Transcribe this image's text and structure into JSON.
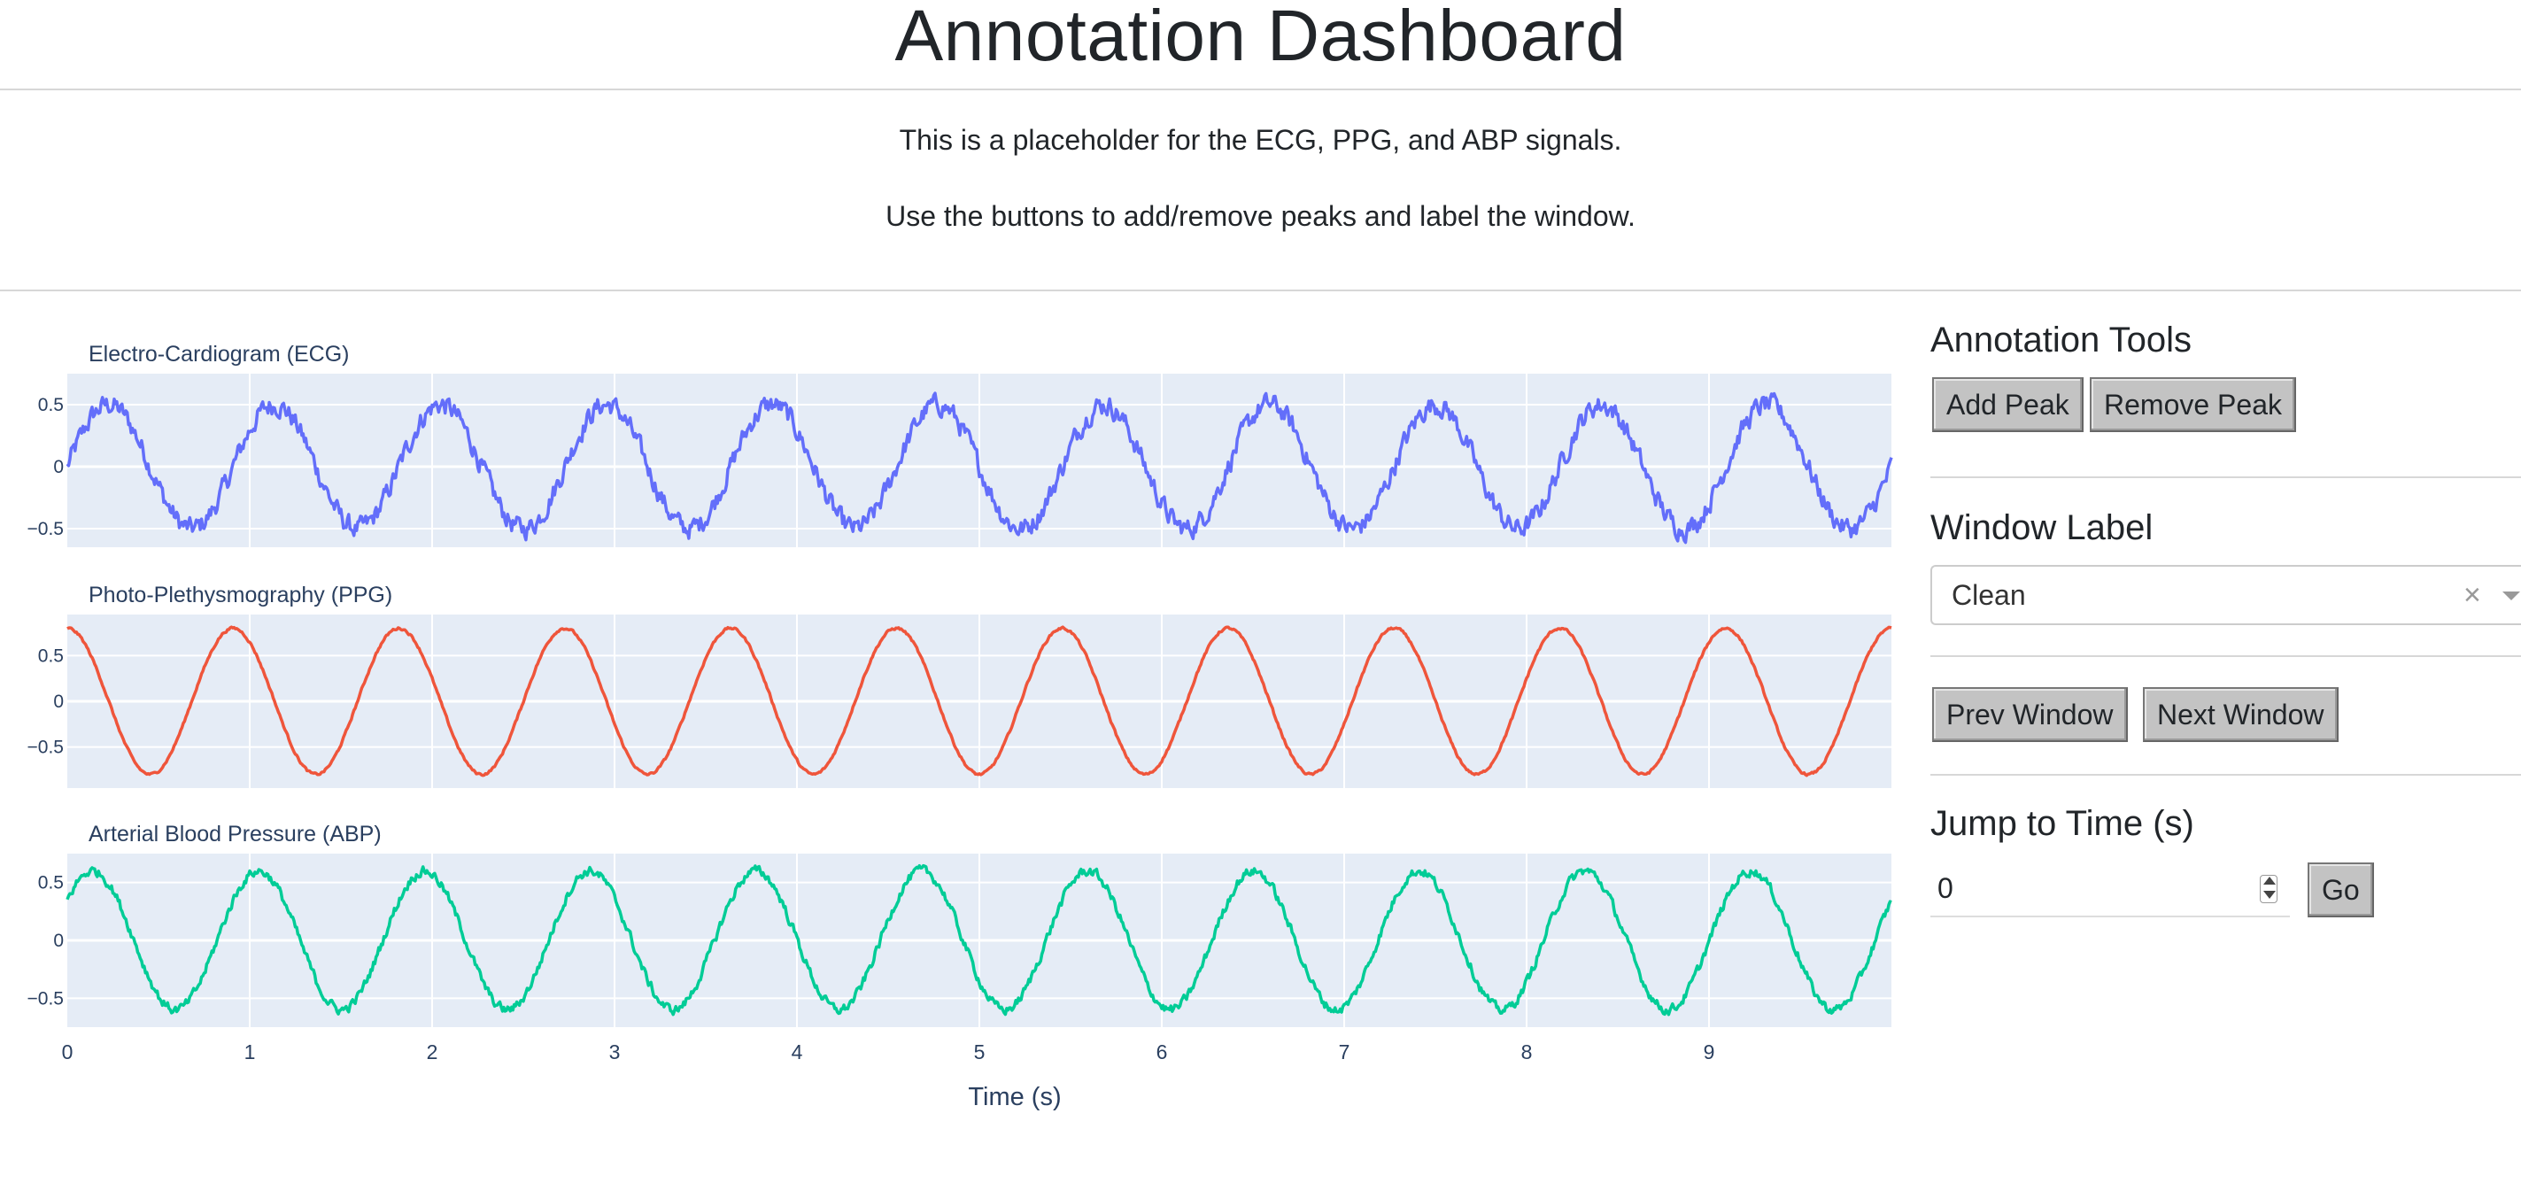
{
  "header": {
    "title": "Annotation Dashboard"
  },
  "intro": {
    "line1": "This is a placeholder for the ECG, PPG, and ABP signals.",
    "line2": "Use the buttons to add/remove peaks and label the window."
  },
  "sidebar": {
    "annotation_tools": {
      "heading": "Annotation Tools",
      "add_peak": "Add Peak",
      "remove_peak": "Remove Peak"
    },
    "window_label": {
      "heading": "Window Label",
      "selected": "Clean",
      "clear_glyph": "×"
    },
    "navigation": {
      "prev": "Prev Window",
      "next": "Next Window"
    },
    "jump": {
      "heading": "Jump to Time (s)",
      "value": "0",
      "go": "Go"
    }
  },
  "chart_data": [
    {
      "type": "line",
      "title": "Electro-Cardiogram (ECG)",
      "color": "#636efa",
      "xlim": [
        0,
        10
      ],
      "ylim": [
        -0.65,
        0.75
      ],
      "yticks": [
        -0.5,
        0,
        0.5
      ],
      "ytick_labels": [
        "−0.5",
        "0",
        "0.5"
      ],
      "frequency_hz": 1.1,
      "amplitude": 0.5,
      "phase_deg": 0,
      "noise": "high"
    },
    {
      "type": "line",
      "title": "Photo-Plethysmography (PPG)",
      "color": "#ef553b",
      "xlim": [
        0,
        10
      ],
      "ylim": [
        -0.95,
        0.95
      ],
      "yticks": [
        -0.5,
        0,
        0.5
      ],
      "ytick_labels": [
        "−0.5",
        "0",
        "0.5"
      ],
      "frequency_hz": 1.1,
      "amplitude": 0.8,
      "phase_deg": 90,
      "noise": "low"
    },
    {
      "type": "line",
      "title": "Arterial Blood Pressure (ABP)",
      "color": "#00cc96",
      "xlim": [
        0,
        10
      ],
      "ylim": [
        -0.75,
        0.75
      ],
      "yticks": [
        -0.5,
        0,
        0.5
      ],
      "ytick_labels": [
        "−0.5",
        "0",
        "0.5"
      ],
      "frequency_hz": 1.1,
      "amplitude": 0.6,
      "phase_deg": 35,
      "noise": "medium",
      "xticks": [
        0,
        1,
        2,
        3,
        4,
        5,
        6,
        7,
        8,
        9
      ],
      "xlabel": "Time (s)"
    }
  ],
  "colors": {
    "plot_bg": "#e5ecf6",
    "grid": "#ffffff",
    "axis_text": "#2a3f5f",
    "button_bg": "#c3c3c3"
  }
}
